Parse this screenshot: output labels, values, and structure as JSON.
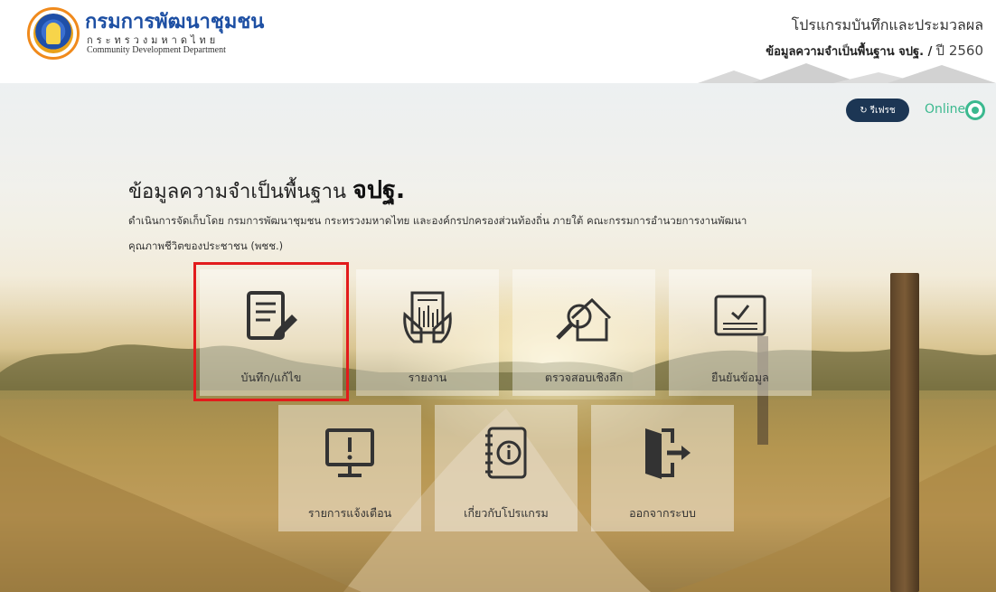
{
  "header": {
    "org_name_th": "กรมการพัฒนาชุมชน",
    "ministry_th": "กระทรวงมหาดไทย",
    "org_name_en": "Community Development Department",
    "program_title": "โปรแกรมบันทึกและประมวลผล",
    "program_subtitle": "ข้อมูลความจำเป็นพื้นฐาน จปฐ. /",
    "year_label": "ปี 2560"
  },
  "status": {
    "refresh_label": "รีเฟรช",
    "online_label": "Online",
    "online_color": "#3bb98f"
  },
  "hero": {
    "headline_prefix": "ข้อมูลความจำเป็นพื้นฐาน",
    "headline_bold": "จปฐ.",
    "desc_line1": "ดำเนินการจัดเก็บโดย กรมการพัฒนาชุมชน กระทรวงมหาดไทย และองค์กรปกครองส่วนท้องถิ่น ภายใต้ คณะกรรมการอำนวยการงานพัฒนา",
    "desc_line2": "คุณภาพชีวิตของประชาชน (พชช.)"
  },
  "menu": {
    "tiles": [
      {
        "label": "บันทึก/แก้ไข",
        "icon": "edit-document-icon",
        "selected": true
      },
      {
        "label": "รายงาน",
        "icon": "report-icon",
        "selected": false
      },
      {
        "label": "ตรวจสอบเชิงลึก",
        "icon": "inspect-house-icon",
        "selected": false
      },
      {
        "label": "ยืนยันข้อมูล",
        "icon": "confirm-icon",
        "selected": false
      },
      {
        "label": "รายการแจ้งเตือน",
        "icon": "alert-monitor-icon",
        "selected": false
      },
      {
        "label": "เกี่ยวกับโปรแกรม",
        "icon": "info-notebook-icon",
        "selected": false
      },
      {
        "label": "ออกจากระบบ",
        "icon": "logout-icon",
        "selected": false
      }
    ],
    "selection_color": "#e21b1b"
  }
}
